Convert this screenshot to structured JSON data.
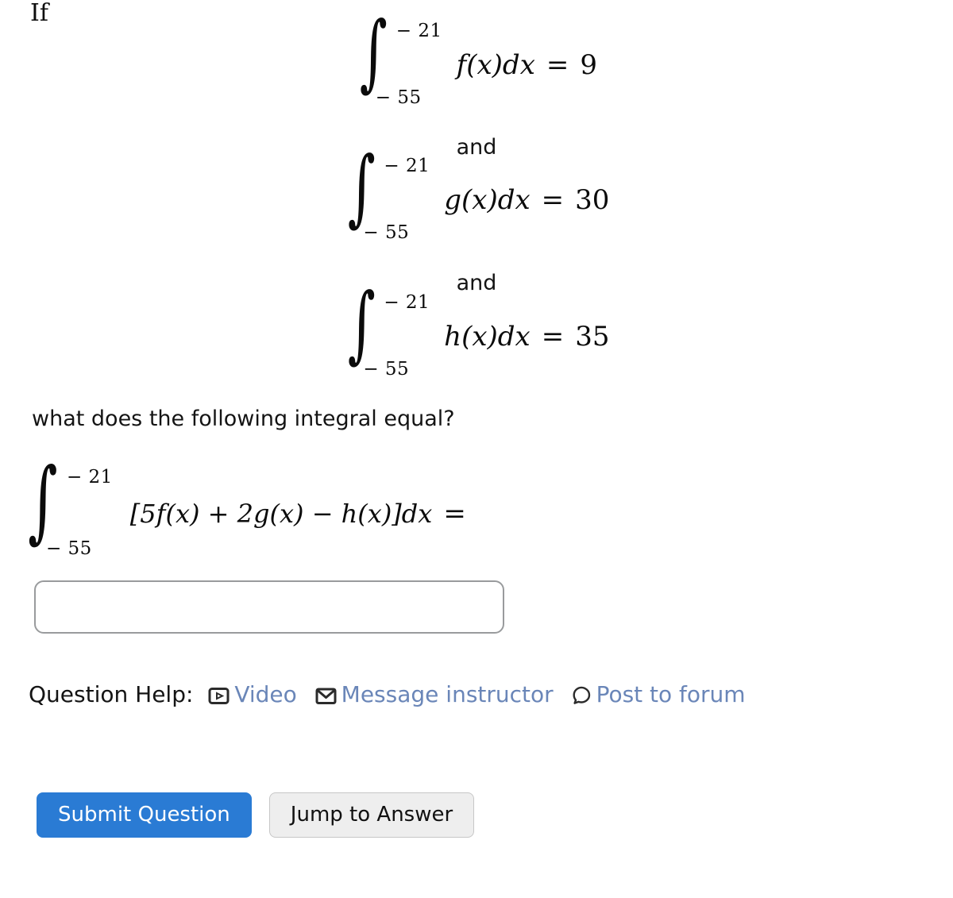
{
  "question": {
    "lead_in": "If",
    "conjunction": "and",
    "prompt": "what does the following integral equal?",
    "given_integrals": [
      {
        "lower_limit": "− 55",
        "upper_limit": "− 21",
        "integrand": "f(x)dx",
        "integrand_fn": "f",
        "equals_sign": "=",
        "value": "9"
      },
      {
        "lower_limit": "− 55",
        "upper_limit": "− 21",
        "integrand": "g(x)dx",
        "integrand_fn": "g",
        "equals_sign": "=",
        "value": "30"
      },
      {
        "lower_limit": "− 55",
        "upper_limit": "− 21",
        "integrand": "h(x)dx",
        "integrand_fn": "h",
        "equals_sign": "=",
        "value": "35"
      }
    ],
    "target_integral": {
      "lower_limit": "− 55",
      "upper_limit": "− 21",
      "integrand": "[5f(x) + 2g(x) − h(x)]dx",
      "equals_sign": "="
    }
  },
  "answer": {
    "value": "",
    "placeholder": ""
  },
  "help": {
    "label": "Question Help:",
    "links": [
      {
        "icon": "video-icon",
        "label": "Video"
      },
      {
        "icon": "envelope-icon",
        "label": "Message instructor"
      },
      {
        "icon": "speech-bubble-icon",
        "label": "Post to forum"
      }
    ]
  },
  "actions": {
    "submit_label": "Submit Question",
    "jump_label": "Jump to Answer"
  },
  "colors": {
    "primary_button": "#2a7bd4",
    "secondary_button": "#eeeeee",
    "link": "#6a86b8",
    "text": "#141414",
    "input_border": "#999b9d"
  }
}
